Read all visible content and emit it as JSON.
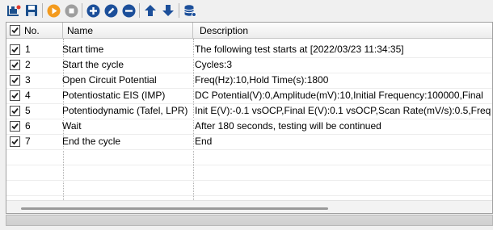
{
  "toolbar": {
    "buttons": [
      {
        "name": "open-icon",
        "color": "#1b4f8c"
      },
      {
        "name": "save-icon",
        "color": "#1b4f8c"
      },
      {
        "name": "run-icon",
        "color": "#f39a1d"
      },
      {
        "name": "stop-icon",
        "color": "#9e9e9e"
      },
      {
        "name": "add-icon",
        "color": "#1c4f9a"
      },
      {
        "name": "edit-icon",
        "color": "#1c4f9a"
      },
      {
        "name": "remove-icon",
        "color": "#1c4f9a"
      },
      {
        "name": "move-up-icon",
        "color": "#1c4f9a"
      },
      {
        "name": "move-down-icon",
        "color": "#1c4f9a"
      },
      {
        "name": "database-icon",
        "color": "#1c4f9a"
      }
    ]
  },
  "table": {
    "columns": {
      "no": "No.",
      "name": "Name",
      "description": "Description"
    },
    "header_checked": true,
    "rows": [
      {
        "no": "1",
        "checked": true,
        "name": "Start time",
        "description": "The following test starts at [2022/03/23 11:34:35]"
      },
      {
        "no": "2",
        "checked": true,
        "name": "Start the cycle",
        "description": "Cycles:3"
      },
      {
        "no": "3",
        "checked": true,
        "name": "Open Circuit Potential",
        "description": "Freq(Hz):10,Hold Time(s):1800"
      },
      {
        "no": "4",
        "checked": true,
        "name": "Potentiostatic EIS (IMP)",
        "description": "DC Potential(V):0,Amplitude(mV):10,Initial Frequency:100000,Final"
      },
      {
        "no": "5",
        "checked": true,
        "name": "Potentiodynamic (Tafel, LPR)",
        "description": "Init E(V):-0.1 vsOCP,Final E(V):0.1 vsOCP,Scan Rate(mV/s):0.5,Freq"
      },
      {
        "no": "6",
        "checked": true,
        "name": "Wait",
        "description": "After 180 seconds, testing will be continued"
      },
      {
        "no": "7",
        "checked": true,
        "name": "End the cycle",
        "description": "End"
      }
    ]
  }
}
